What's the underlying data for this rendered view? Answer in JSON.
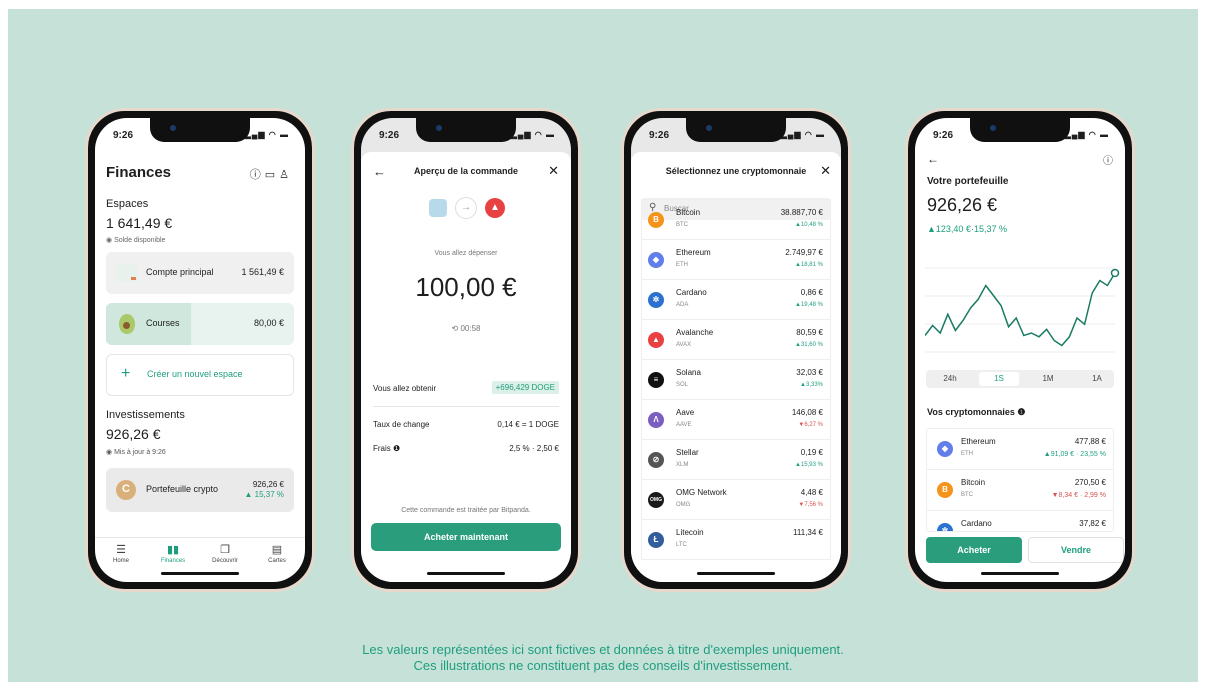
{
  "disclaimer": {
    "line1": "Les valeurs représentées ici sont fictives et données à titre d'exemples uniquement.",
    "line2": "Ces illustrations ne constituent pas des conseils d'investissement."
  },
  "status_time": "9:26",
  "status_icons": "signal-wifi-battery-icons",
  "phone1": {
    "title": "Finances",
    "header_icons": [
      "info-icon",
      "message-icon",
      "profile-icon"
    ],
    "espaces_label": "Espaces",
    "balance": "1 641,49 €",
    "solde_label": "Solde disponible",
    "spaces": [
      {
        "label": "Compte principal",
        "amount": "1 561,49 €"
      },
      {
        "label": "Courses",
        "amount": "80,00 €"
      }
    ],
    "create_space": "Créer un nouvel espace",
    "invest_label": "Investissements",
    "invest_amount": "926,26 €",
    "updated": "Mis à jour à 9:26",
    "crypto_wallet": {
      "label": "Portefeuille crypto",
      "amount": "926,26 €",
      "change": "▲ 15,37 %"
    },
    "tabs": [
      {
        "label": "Home",
        "icon": "home-icon"
      },
      {
        "label": "Finances",
        "icon": "chart-icon"
      },
      {
        "label": "Découvrir",
        "icon": "cards-icon"
      },
      {
        "label": "Cartes",
        "icon": "card-icon"
      }
    ]
  },
  "phone2": {
    "title": "Aperçu de la commande",
    "spend_label": "Vous allez dépenser",
    "amount": "100,00 €",
    "timer": "00:58",
    "receive_label": "Vous allez obtenir",
    "receive_value": "+696,429 DOGE",
    "rate_label": "Taux de change",
    "rate_value": "0,14 € = 1 DOGE",
    "fees_label": "Frais",
    "fees_value": "2,5 % · 2,50 €",
    "processed": "Cette commande est traitée par Bitpanda.",
    "buy_button": "Acheter maintenant"
  },
  "phone3": {
    "title": "Sélectionnez une cryptomonnaie",
    "search_placeholder": "Buscar",
    "coins": [
      {
        "name": "Bitcoin",
        "symbol": "BTC",
        "price": "38.887,70 €",
        "change": "▲10,48 %",
        "dir": "up",
        "color": "#f7931a",
        "glyph": "B"
      },
      {
        "name": "Ethereum",
        "symbol": "ETH",
        "price": "2.749,97 €",
        "change": "▲18,81 %",
        "dir": "up",
        "color": "#627eea",
        "glyph": "◆"
      },
      {
        "name": "Cardano",
        "symbol": "ADA",
        "price": "0,86 €",
        "change": "▲19,48 %",
        "dir": "up",
        "color": "#2a71d0",
        "glyph": "✲"
      },
      {
        "name": "Avalanche",
        "symbol": "AVAX",
        "price": "80,59 €",
        "change": "▲31,60 %",
        "dir": "up",
        "color": "#e84142",
        "glyph": "▲"
      },
      {
        "name": "Solana",
        "symbol": "SOL",
        "price": "32,03 €",
        "change": "▲3,33%",
        "dir": "up",
        "color": "#111111",
        "glyph": "≡"
      },
      {
        "name": "Aave",
        "symbol": "AAVE",
        "price": "146,08 €",
        "change": "▼6,27 %",
        "dir": "down",
        "color": "#7b5fc0",
        "glyph": "Λ"
      },
      {
        "name": "Stellar",
        "symbol": "XLM",
        "price": "0,19 €",
        "change": "▲15,93 %",
        "dir": "up",
        "color": "#555555",
        "glyph": "⊘"
      },
      {
        "name": "OMG Network",
        "symbol": "OMG",
        "price": "4,48 €",
        "change": "▼7,56 %",
        "dir": "down",
        "color": "#1a1a1a",
        "glyph": "OMG"
      },
      {
        "name": "Litecoin",
        "symbol": "LTC",
        "price": "111,34 €",
        "change": "",
        "dir": "up",
        "color": "#345d9d",
        "glyph": "Ł"
      }
    ]
  },
  "phone4": {
    "title": "Votre portefeuille",
    "amount": "926,26 €",
    "change": "▲123,40 €·15,37 %",
    "chart_data": {
      "type": "line",
      "values": [
        62,
        54,
        60,
        45,
        58,
        50,
        40,
        33,
        22,
        30,
        38,
        55,
        48,
        62,
        60,
        63,
        57,
        66,
        70,
        63,
        48,
        53,
        28,
        18,
        22,
        12
      ],
      "color": "#1a7a63"
    },
    "ranges": [
      "24h",
      "1S",
      "1M",
      "1A"
    ],
    "active_range": "1S",
    "vos_label": "Vos cryptomonnaies",
    "holdings": [
      {
        "name": "Ethereum",
        "symbol": "ETH",
        "price": "477,88 €",
        "change": "▲91,09 € · 23,55 %",
        "dir": "up",
        "color": "#627eea",
        "glyph": "◆"
      },
      {
        "name": "Bitcoin",
        "symbol": "BTC",
        "price": "270,50 €",
        "change": "▼8,34 € · 2,99 %",
        "dir": "down",
        "color": "#f7931a",
        "glyph": "B"
      },
      {
        "name": "Cardano",
        "symbol": "ADA",
        "price": "37,82 €",
        "change": "",
        "dir": "up",
        "color": "#2a71d0",
        "glyph": "✲"
      }
    ],
    "buy_button": "Acheter",
    "sell_button": "Vendre"
  }
}
